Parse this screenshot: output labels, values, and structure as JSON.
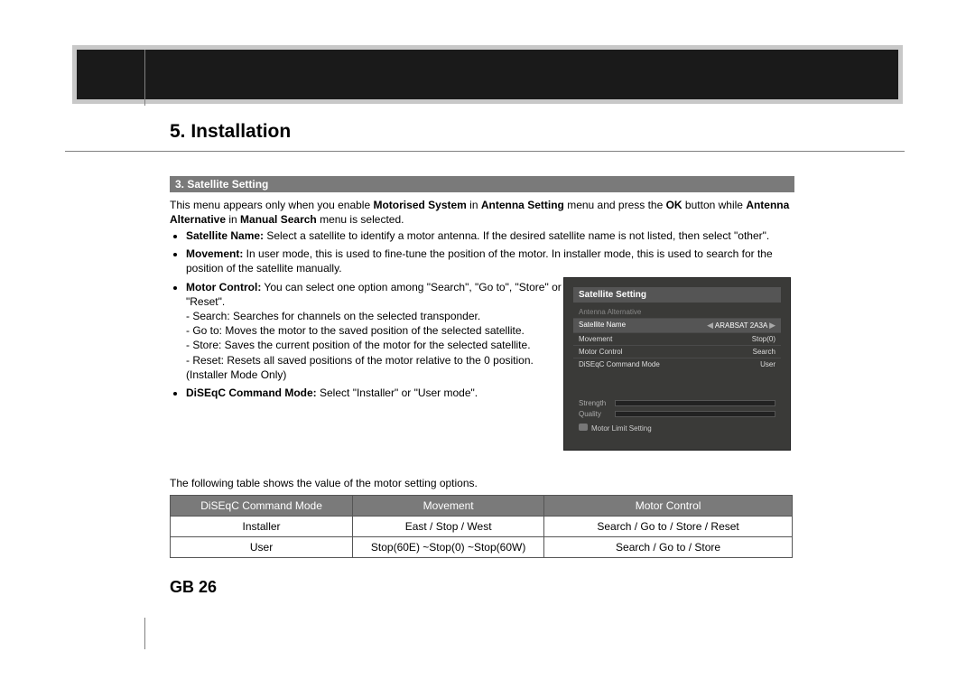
{
  "heading": "5. Installation",
  "section_title": "3. Satellite Setting",
  "intro": {
    "p1a": "This menu appears only when you enable ",
    "b1": "Motorised System",
    "p1b": " in ",
    "b2": "Antenna Setting",
    "p1c": " menu and press the ",
    "b3": "OK",
    "p1d": " button while ",
    "b4": "Antenna Alternative",
    "p1e": " in ",
    "b5": "Manual Search",
    "p1f": " menu is selected."
  },
  "bullets": {
    "sat_name_b": "Satellite Name:",
    "sat_name_t": " Select a satellite to identify a motor antenna. If the desired satellite name is not listed, then select \"other\".",
    "move_b": "Movement:",
    "move_t": " In user mode, this is used to fine-tune the position of the motor. In installer mode, this is used to search for the position of the satellite manually.",
    "motor_b": "Motor Control:",
    "motor_t": " You can select one option among \"Search\", \"Go to\", \"Store\" or \"Reset\".",
    "motor_l1": "- Search: Searches for channels on the selected transponder.",
    "motor_l2": "- Go to: Moves the motor to the saved position of the selected satellite.",
    "motor_l3": "- Store: Saves the current position of the motor for the selected satellite.",
    "motor_l4": "- Reset: Resets all saved positions of the motor relative to the 0 position.",
    "motor_l5": "(Installer Mode Only)",
    "diseqc_b": "DiSEqC Command Mode:",
    "diseqc_t": " Select \"Installer\" or \"User mode\"."
  },
  "tv": {
    "title": "Satellite Setting",
    "sub": "Antenna Alternative",
    "rows": [
      {
        "l": "Satellite Name",
        "v": "ARABSAT 2A3A"
      },
      {
        "l": "Movement",
        "v": "Stop(0)"
      },
      {
        "l": "Motor Control",
        "v": "Search"
      },
      {
        "l": "DiSEqC Command Mode",
        "v": "User"
      }
    ],
    "strength": "Strength",
    "quality": "Quality",
    "foot": "Motor Limit Setting"
  },
  "table_intro": "The following table shows the value of the motor setting options.",
  "table": {
    "h1": "DiSEqC Command Mode",
    "h2": "Movement",
    "h3": "Motor Control",
    "r1c1": "Installer",
    "r1c2": "East / Stop / West",
    "r1c3": "Search / Go to / Store / Reset",
    "r2c1": "User",
    "r2c2": "Stop(60E) ~Stop(0) ~Stop(60W)",
    "r2c3": "Search / Go to / Store"
  },
  "page_no": "GB 26"
}
